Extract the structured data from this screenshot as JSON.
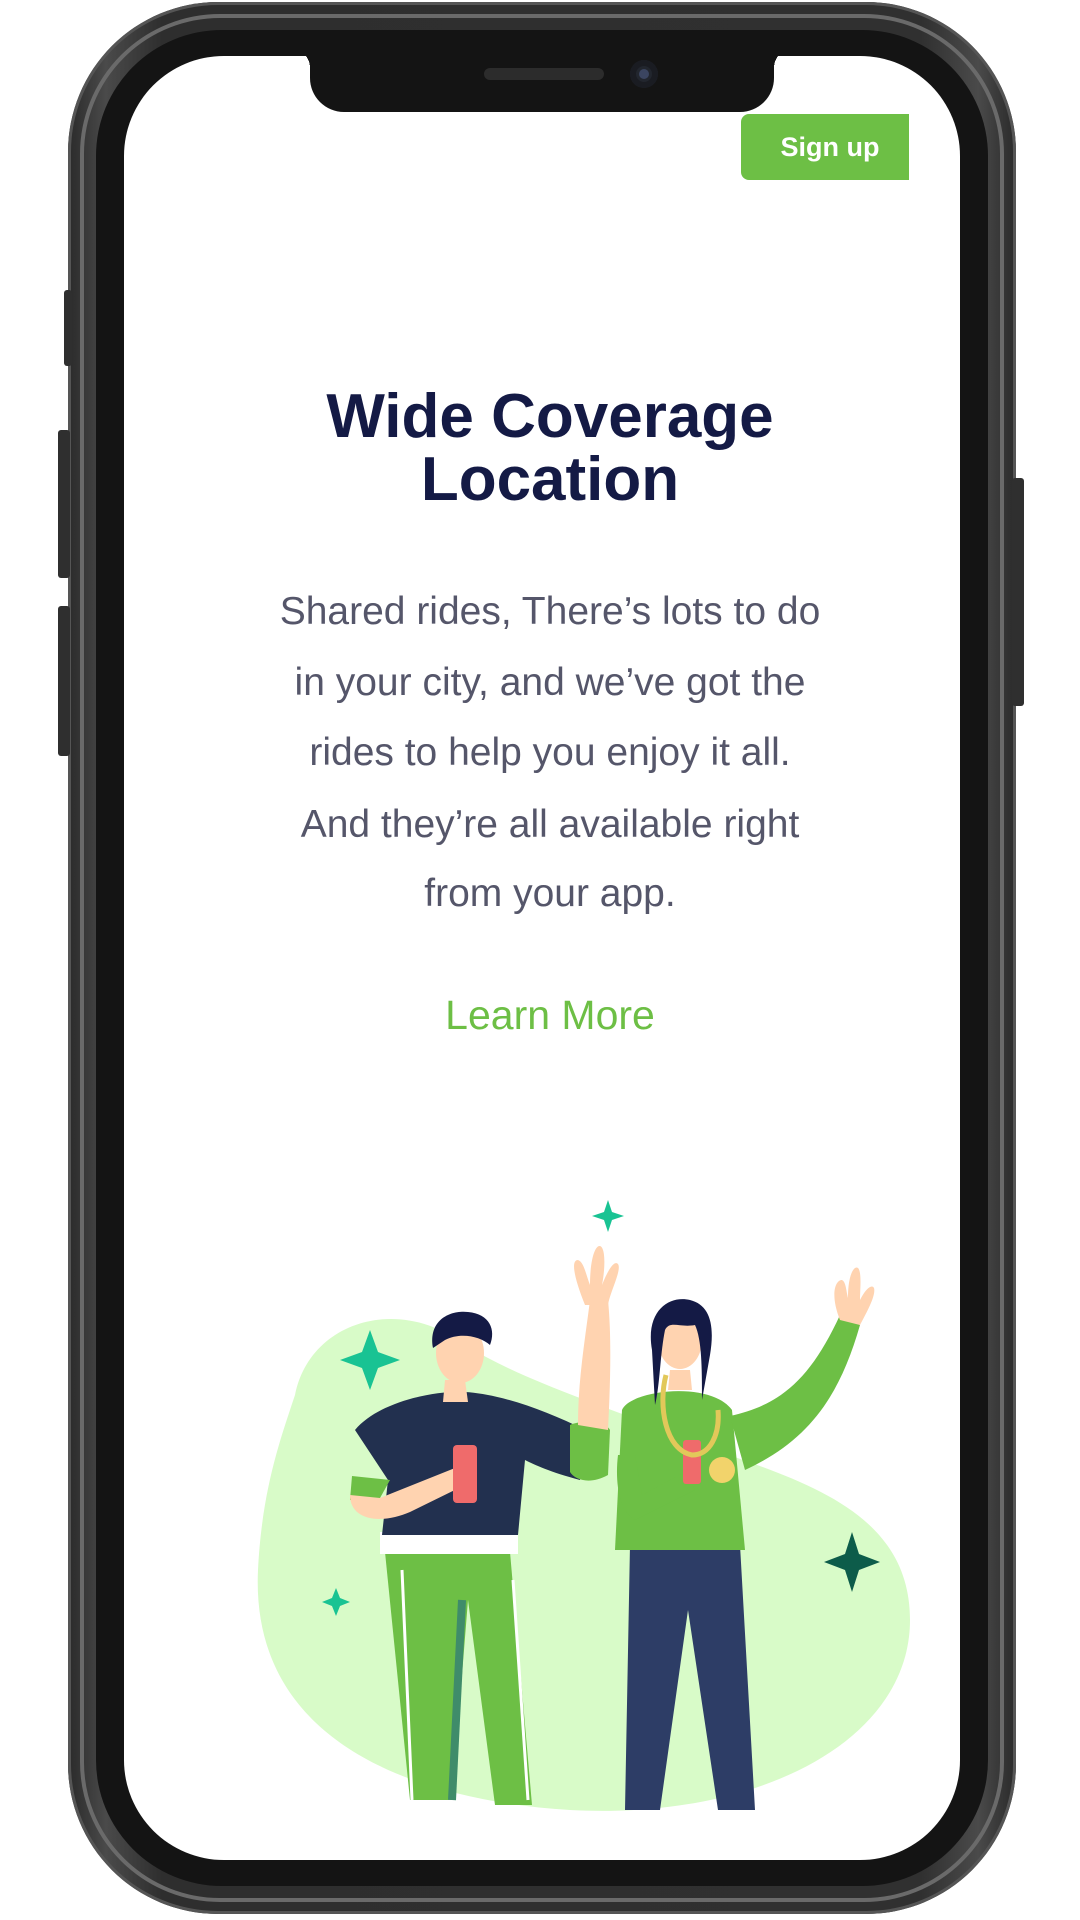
{
  "header": {
    "signup_label": "Sign up"
  },
  "hero": {
    "title_line1": "Wide Coverage",
    "title_line2": "Location",
    "description_lines": [
      "Shared rides, There’s lots to do",
      "in your city, and we’ve got the",
      "rides to help you enjoy it all.",
      "And they’re all available right",
      "from your app."
    ],
    "cta_label": "Learn More"
  },
  "colors": {
    "accent": "#6dbf45",
    "heading": "#141a45",
    "body_text": "#55566a",
    "blob": "#d8fbc8",
    "navy": "#22304f",
    "teal_sparkle": "#19c393"
  }
}
